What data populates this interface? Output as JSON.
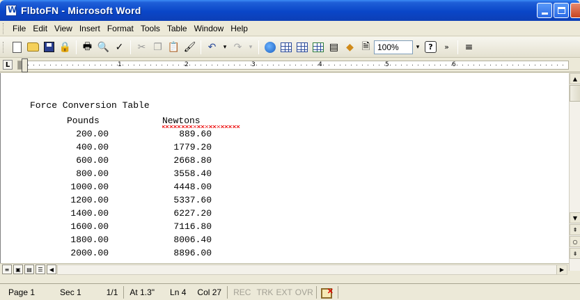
{
  "window": {
    "title": "FlbtoFN - Microsoft Word"
  },
  "menu": {
    "items": [
      "File",
      "Edit",
      "View",
      "Insert",
      "Format",
      "Tools",
      "Table",
      "Window",
      "Help"
    ]
  },
  "toolbar": {
    "zoom": "100%",
    "icons": [
      "new-icon",
      "open-icon",
      "save-icon",
      "permission-icon",
      "print-icon",
      "print-preview-icon",
      "spelling-icon",
      "cut-icon",
      "copy-icon",
      "paste-icon",
      "format-painter-icon",
      "undo-icon",
      "redo-icon",
      "hyperlink-icon",
      "tables-borders-icon",
      "insert-table-icon",
      "insert-excel-icon",
      "columns-icon",
      "drawing-icon",
      "document-map-icon",
      "help-icon"
    ]
  },
  "ruler": {
    "numbers": [
      "1",
      "2",
      "3",
      "4",
      "5",
      "6"
    ]
  },
  "document": {
    "heading": "Force Conversion Table",
    "col_pounds": "Pounds",
    "col_newtons": "Newtons",
    "rows": [
      {
        "pounds": "200.00",
        "newtons": "889.60"
      },
      {
        "pounds": "400.00",
        "newtons": "1779.20"
      },
      {
        "pounds": "600.00",
        "newtons": "2668.80"
      },
      {
        "pounds": "800.00",
        "newtons": "3558.40"
      },
      {
        "pounds": "1000.00",
        "newtons": "4448.00"
      },
      {
        "pounds": "1200.00",
        "newtons": "5337.60"
      },
      {
        "pounds": "1400.00",
        "newtons": "6227.20"
      },
      {
        "pounds": "1600.00",
        "newtons": "7116.80"
      },
      {
        "pounds": "1800.00",
        "newtons": "8006.40"
      },
      {
        "pounds": "2000.00",
        "newtons": "8896.00"
      }
    ]
  },
  "status": {
    "page": "Page 1",
    "sec": "Sec 1",
    "pages": "1/1",
    "at": "At 1.3\"",
    "ln": "Ln 4",
    "col": "Col 27",
    "rec": "REC",
    "trk": "TRK",
    "ext": "EXT",
    "ovr": "OVR"
  }
}
